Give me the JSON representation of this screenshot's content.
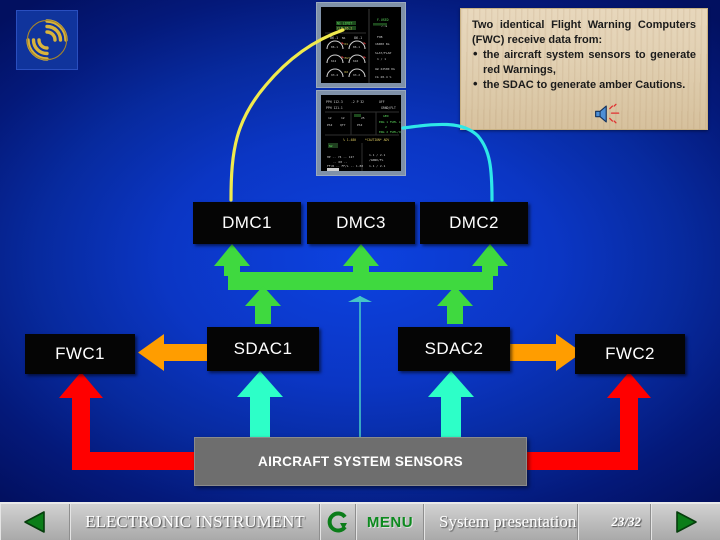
{
  "page": {
    "title": "System presentation",
    "section": "ELECTRONIC INSTRUMENT",
    "page_counter": "23/32",
    "background_color": "#0b36c4"
  },
  "logo": {
    "name": "company-logo",
    "color": "#d9b43c",
    "bg": "#10349c"
  },
  "callout": {
    "lead": "Two identical Flight Warning Computers (FWC) receive data from:",
    "bullets": [
      "the aircraft system sensors to generate red Warnings,",
      "the SDAC to generate amber Cautions."
    ],
    "bg_color": "#e3d2b5",
    "speaker_icon": "speaker-icon"
  },
  "displays": [
    {
      "name": "ecam-upper-display",
      "label": "ECAM Engine/Warning Display"
    },
    {
      "name": "ecam-lower-display",
      "label": "ECAM System/Status Display"
    }
  ],
  "diagram": {
    "dmc": [
      {
        "id": "dmc1",
        "label": "DMC1"
      },
      {
        "id": "dmc3",
        "label": "DMC3"
      },
      {
        "id": "dmc2",
        "label": "DMC2"
      }
    ],
    "sdac": [
      {
        "id": "sdac1",
        "label": "SDAC1"
      },
      {
        "id": "sdac2",
        "label": "SDAC2"
      }
    ],
    "fwc": [
      {
        "id": "fwc1",
        "label": "FWC1"
      },
      {
        "id": "fwc2",
        "label": "FWC2"
      }
    ],
    "sensors": {
      "id": "sensors",
      "label": "AIRCRAFT SYSTEM SENSORS"
    },
    "flows": [
      {
        "from": "SDAC1/SDAC2",
        "to": "DMC1/DMC3/DMC2",
        "color": "#3fd93f",
        "meaning": "display data bus"
      },
      {
        "from": "SDAC1",
        "to": "FWC1",
        "color": "#ff9d00",
        "meaning": "amber Cautions"
      },
      {
        "from": "SDAC2",
        "to": "FWC2",
        "color": "#ff9d00",
        "meaning": "amber Cautions"
      },
      {
        "from": "AIRCRAFT SYSTEM SENSORS",
        "to": "SDAC1",
        "color": "#2dffc8",
        "meaning": "sensor data"
      },
      {
        "from": "AIRCRAFT SYSTEM SENSORS",
        "to": "SDAC2",
        "color": "#2dffc8",
        "meaning": "sensor data"
      },
      {
        "from": "AIRCRAFT SYSTEM SENSORS",
        "to": "FWC1",
        "color": "#ff0000",
        "meaning": "red Warnings"
      },
      {
        "from": "AIRCRAFT SYSTEM SENSORS",
        "to": "FWC2",
        "color": "#ff0000",
        "meaning": "red Warnings"
      },
      {
        "from": "DMC1",
        "to": "ECAM upper display",
        "color": "#f5f04a",
        "meaning": "upper display feed"
      },
      {
        "from": "DMC2",
        "to": "ECAM lower display",
        "color": "#2ee8e8",
        "meaning": "lower display feed"
      }
    ]
  },
  "navbar": {
    "prev_icon": "previous-arrow-icon",
    "section_label": "ELECTRONIC INSTRUMENT",
    "refresh_icon": "refresh-icon",
    "menu_label": "MENU",
    "subtitle": "System presentation",
    "counter": "23/32",
    "next_icon": "next-arrow-icon"
  }
}
